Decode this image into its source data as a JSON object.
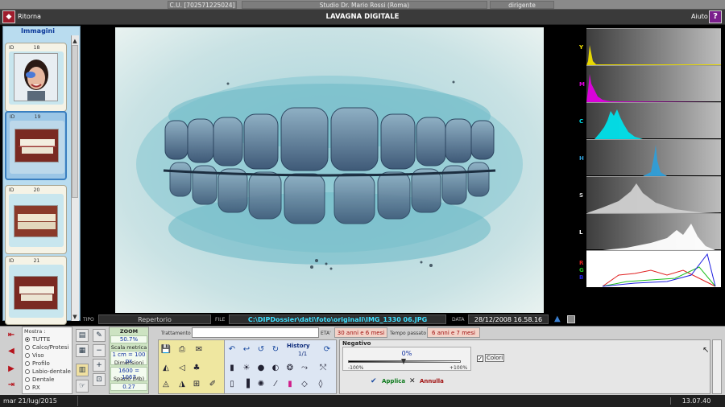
{
  "topstrip": {
    "cu": "C.U. [702571225024]",
    "studio": "Studio Dr. Mario Rossi (Roma)",
    "role": "dirigente"
  },
  "titlebar": {
    "back_label": "Ritorna",
    "title": "LAVAGNA DIGITALE",
    "help_label": "Aiuto",
    "help_icon": "?",
    "back_icon": "◆"
  },
  "imglist": {
    "title": "Immagini",
    "id_label": "ID",
    "cards": [
      {
        "id": "18",
        "type": "face"
      },
      {
        "id": "19",
        "type": "teeth",
        "selected": true
      },
      {
        "id": "20",
        "type": "teeth-side"
      },
      {
        "id": "21",
        "type": "teeth"
      }
    ]
  },
  "histograms": [
    {
      "label": "Y",
      "color": "#f0e000"
    },
    {
      "label": "M",
      "color": "#e000e0"
    },
    {
      "label": "C",
      "color": "#00e0ea"
    },
    {
      "label": "H",
      "color": "#2f9ed8"
    },
    {
      "label": "S",
      "color": "#d0d0d0"
    },
    {
      "label": "L",
      "color": "#ffffff"
    },
    {
      "labels": [
        "R",
        "G",
        "B"
      ],
      "colors": [
        "#e02020",
        "#20c020",
        "#2020e0"
      ]
    }
  ],
  "info": {
    "tipo_label": "TIPO",
    "tipo_value": "Repertorio",
    "file_label": "FILE",
    "file_value": "C:\\DIPDossier\\dati\\foto\\originali\\IMG_1330 06.JPG",
    "data_label": "DATA",
    "data_value": "28/12/2008 16.58.16"
  },
  "filter": {
    "header": "Mostra :",
    "options": [
      {
        "label": "TUTTE",
        "selected": true
      },
      {
        "label": "Calco/Protesi"
      },
      {
        "label": "Viso"
      },
      {
        "label": "Profilo"
      },
      {
        "label": "Labio-dentale"
      },
      {
        "label": "Dentale"
      },
      {
        "label": "RX"
      }
    ]
  },
  "zoom": {
    "title": "ZOOM",
    "value": "50.7%",
    "scale_label": "Scala metrica",
    "scale_value": "1 cm = 100 px",
    "dim_label": "Dimensioni (pixels)",
    "dim_value": "1600 = 1067",
    "space_label": "Spazio (Mb)",
    "space_value": "0.27"
  },
  "trattamento": {
    "label": "Trattamento",
    "value": ""
  },
  "eta": {
    "label": "ETA'",
    "value": "30 anni e 6 mesi"
  },
  "tempo": {
    "label": "Tempo passato",
    "value": "6 anni e 7 mesi"
  },
  "history": {
    "label": "History",
    "value": "1/1"
  },
  "negativo": {
    "title": "Negativo",
    "value": "0%",
    "min": "-100%",
    "max": "+100%",
    "level": 0,
    "colori_label": "Colori",
    "colori_checked": true,
    "applica": "Applica",
    "annulla": "Annulla"
  },
  "status": {
    "date": "mar 21/lug/2015",
    "time": "13.07.40"
  }
}
